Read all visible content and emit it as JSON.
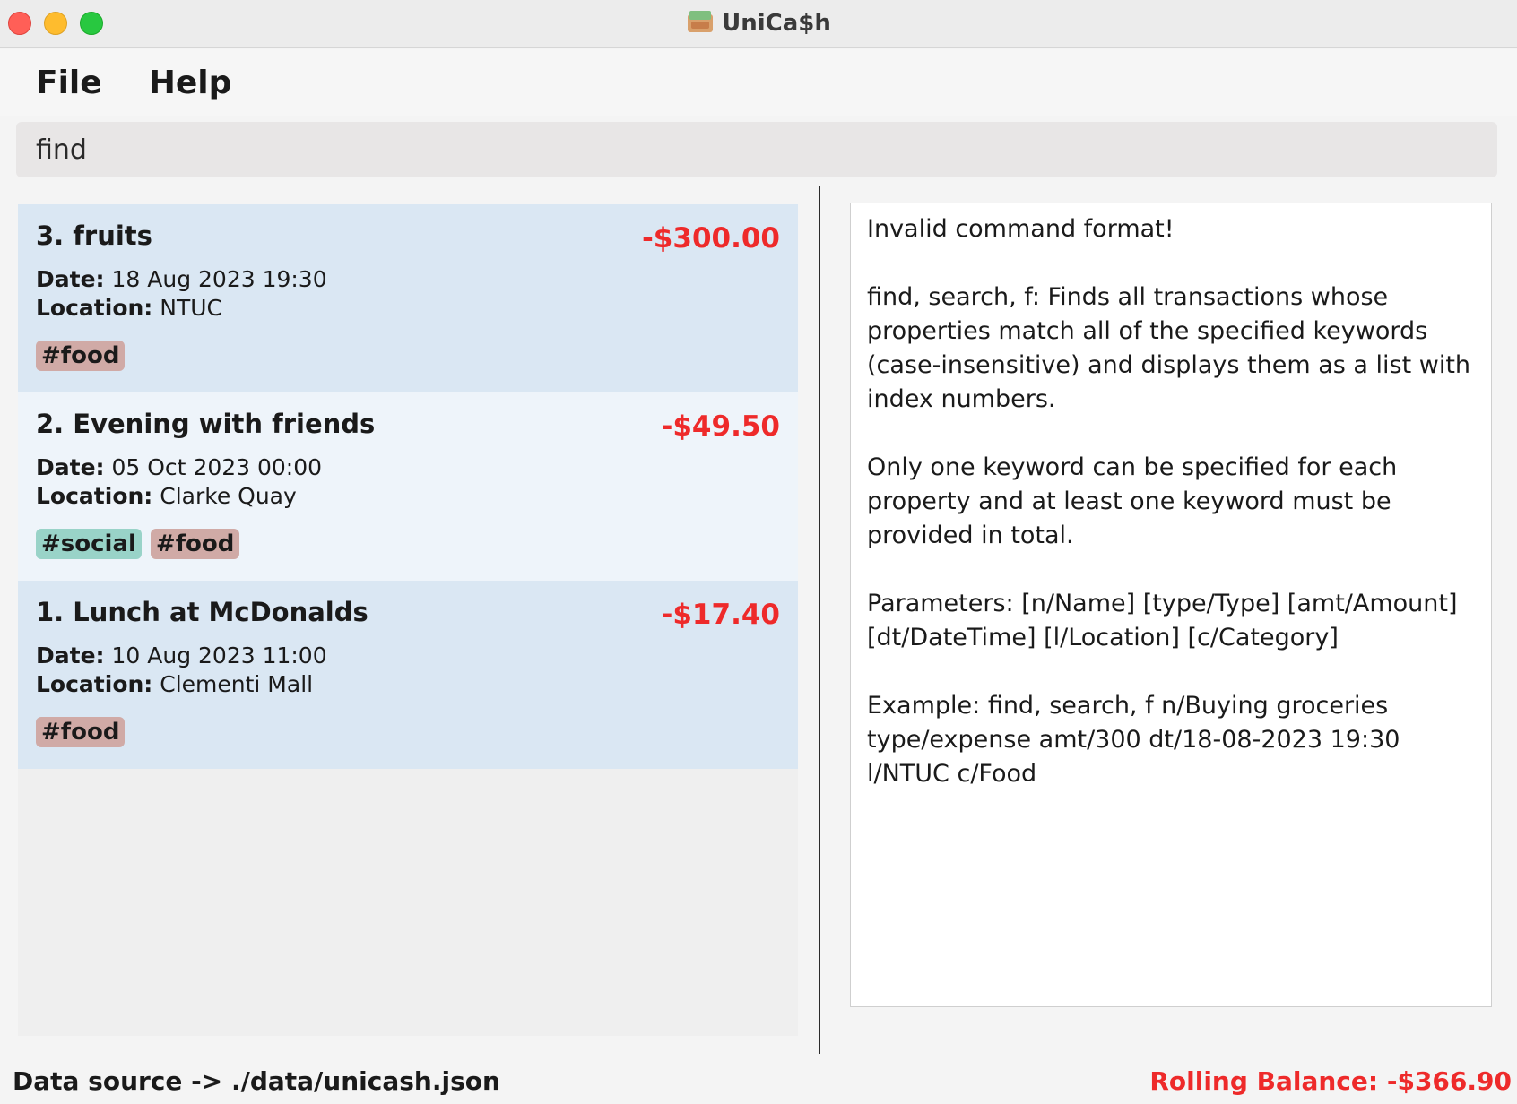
{
  "window": {
    "title": "UniCa$h"
  },
  "menu": {
    "items": [
      {
        "label": "File"
      },
      {
        "label": "Help"
      }
    ]
  },
  "command_box": {
    "value": "find"
  },
  "transactions": [
    {
      "title": "3. fruits",
      "amount": "-$300.00",
      "date_label": "Date:",
      "date": "18 Aug 2023 19:30",
      "location_label": "Location:",
      "location": "NTUC",
      "tags": [
        "#food"
      ]
    },
    {
      "title": "2. Evening with friends",
      "amount": "-$49.50",
      "date_label": "Date:",
      "date": "05 Oct 2023 00:00",
      "location_label": "Location:",
      "location": "Clarke Quay",
      "tags": [
        "#social",
        "#food"
      ]
    },
    {
      "title": "1. Lunch at McDonalds",
      "amount": "-$17.40",
      "date_label": "Date:",
      "date": "10 Aug 2023 11:00",
      "location_label": "Location:",
      "location": "Clementi Mall",
      "tags": [
        "#food"
      ]
    }
  ],
  "result_display": {
    "text": "Invalid command format!\n\nfind, search, f: Finds all transactions whose properties match all of the specified keywords (case-insensitive) and displays them as a list with index numbers.\n\nOnly one keyword can be specified for each property and at least one keyword must be provided in total.\n\nParameters: [n/Name] [type/Type] [amt/Amount] [dt/DateTime] [l/Location] [c/Category]\n\nExample: find, search, f n/Buying groceries type/expense amt/300 dt/18-08-2023 19:30 l/NTUC c/Food"
  },
  "status_bar": {
    "data_source": "Data source -> ./data/unicash.json",
    "rolling_balance": "Rolling Balance: -$366.90"
  },
  "colors": {
    "expense_red": "#ee2a2a",
    "card_odd": "#dae7f3",
    "card_even": "#eef4fa",
    "tag_food": "#d0aaa6",
    "tag_social": "#99d3c8"
  }
}
